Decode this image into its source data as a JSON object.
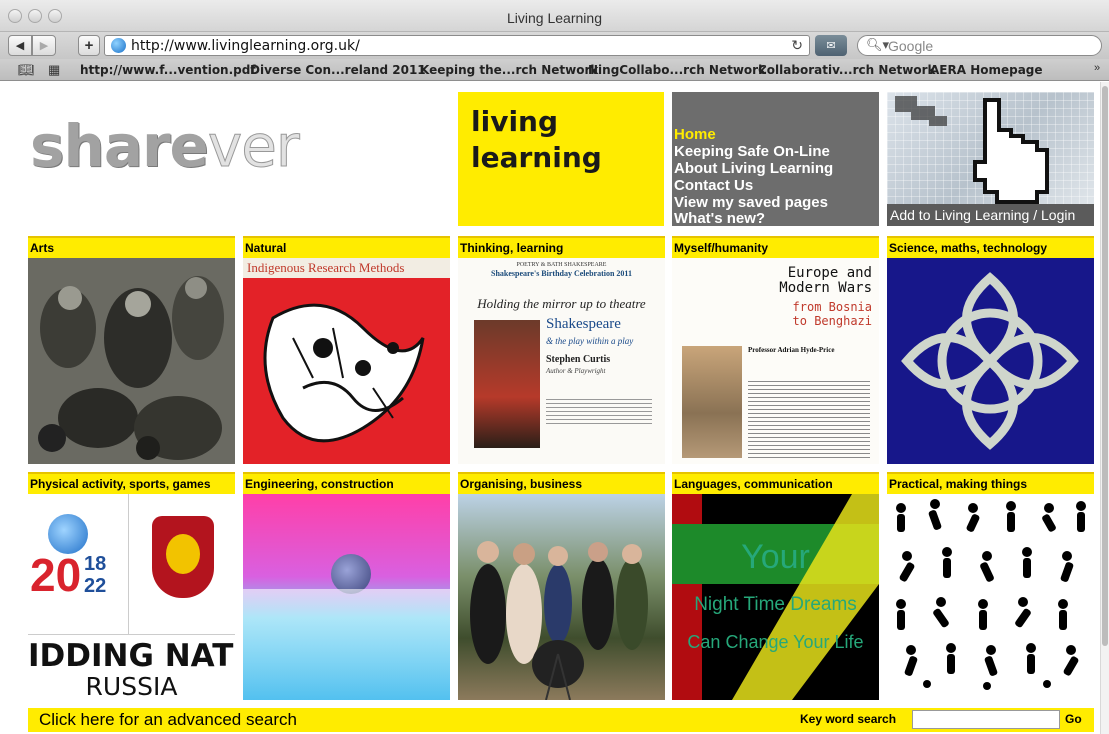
{
  "window": {
    "title": "Living Learning"
  },
  "toolbar": {
    "url": "http://www.livinglearning.org.uk/",
    "search_placeholder": "Google"
  },
  "bookmarks": [
    "http://www.f...vention.pdf",
    "Diverse Con...reland 2011",
    "Keeping the...rch Network",
    "NingCollabo...rch Network",
    "Collaborativ...rch Network",
    "AERA Homepage"
  ],
  "logo": {
    "part1": "share",
    "part2": "ver"
  },
  "brand": {
    "line1": "living",
    "line2": "learning"
  },
  "nav": {
    "items": [
      "Home",
      "Keeping Safe On-Line",
      "About Living Learning",
      "Contact Us",
      "View my saved pages",
      "What's new?"
    ]
  },
  "login": {
    "label": "Add to Living Learning / Login"
  },
  "categories": [
    {
      "label": "Arts"
    },
    {
      "label": "Natural"
    },
    {
      "label": "Thinking, learning"
    },
    {
      "label": "Myself/humanity"
    },
    {
      "label": "Science, maths, technology"
    },
    {
      "label": "Physical activity, sports, games"
    },
    {
      "label": "Engineering, construction"
    },
    {
      "label": "Organising, business"
    },
    {
      "label": "Languages, communication"
    },
    {
      "label": "Practical, making things"
    }
  ],
  "tile_text": {
    "natural_heading": "Indigenous Research Methods",
    "poster_header": "POETRY & BATH SHAKESPEARE",
    "poster_subheader": "Shakespeare's Birthday Celebration 2011",
    "poster_tagline": "Holding the mirror up to theatre",
    "poster_title": "Shakespeare",
    "poster_subtitle": "& the play within a play",
    "poster_speaker": "Stephen Curtis",
    "poster_role": "Author & Playwright",
    "book_line1": "Europe and",
    "book_line2": "Modern Wars",
    "book_line3": "from Bosnia",
    "book_line4": "to Benghazi",
    "book_author": "Professor Adrian Hyde-Price",
    "sport_year_top": "18",
    "sport_year_bottom": "22",
    "sport_bidding": "IDDING NATIO",
    "sport_country": "RUSSIA",
    "lang_line1": "Your",
    "lang_line2": "Night Time Dreams",
    "lang_line3": "Can Change Your Life"
  },
  "search": {
    "advanced_label": "Click here for an advanced search",
    "keyword_label": "Key word search",
    "keyword_value": "",
    "go_label": "Go"
  },
  "colors": {
    "brand_yellow": "#ffec00",
    "nav_grey": "#6d6d6d"
  }
}
